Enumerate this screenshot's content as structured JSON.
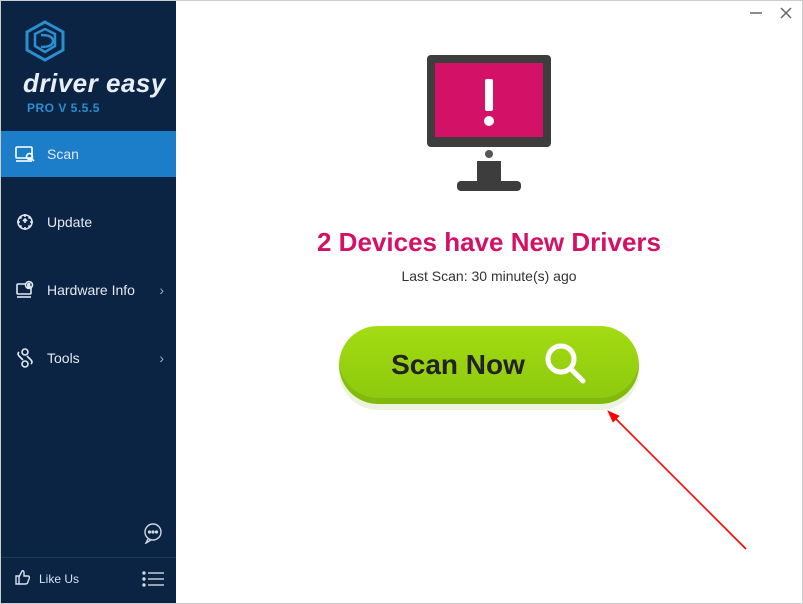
{
  "brand": {
    "name": "driver easy",
    "version": "PRO V 5.5.5"
  },
  "sidebar": {
    "items": [
      {
        "label": "Scan"
      },
      {
        "label": "Update"
      },
      {
        "label": "Hardware Info"
      },
      {
        "label": "Tools"
      }
    ],
    "like_label": "Like Us"
  },
  "main": {
    "headline": "2 Devices have New Drivers",
    "last_scan": "Last Scan: 30 minute(s) ago",
    "scan_button": "Scan Now"
  },
  "colors": {
    "accent_pink": "#d31166",
    "scan_green": "#99d40e",
    "sidebar_bg": "#0b2444",
    "sidebar_active": "#1c7ec9"
  }
}
